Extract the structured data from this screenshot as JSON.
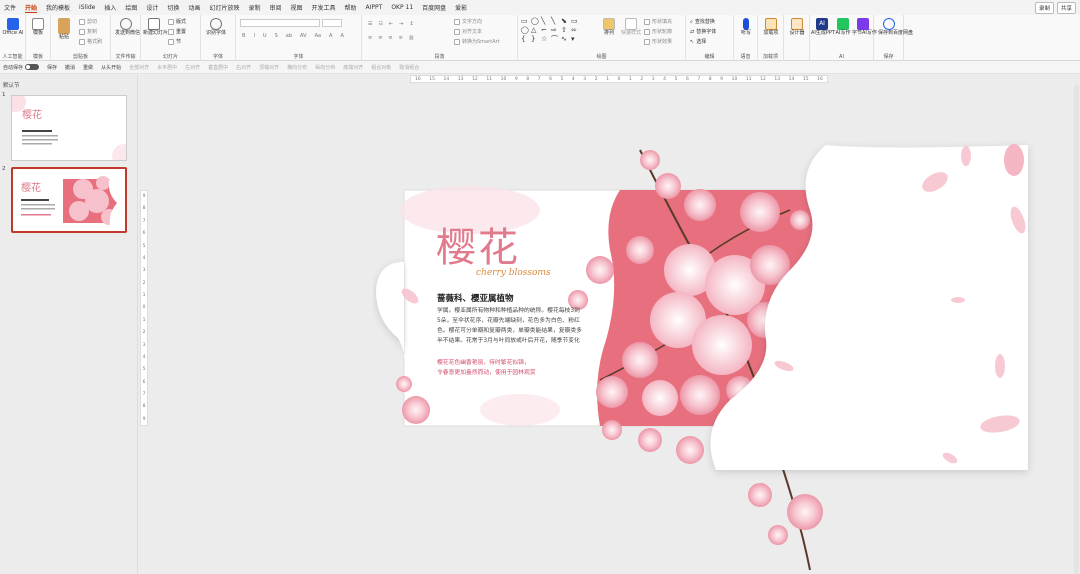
{
  "menu": {
    "tabs": [
      "文件",
      "开始",
      "我的模板",
      "iSlide",
      "插入",
      "绘图",
      "设计",
      "切换",
      "动画",
      "幻灯片放映",
      "录制",
      "审阅",
      "视图",
      "开发工具",
      "帮助",
      "AIPPT",
      "OKP 11",
      "百度网盘",
      "爱影"
    ],
    "active": "开始",
    "record_button": "录制",
    "share_button": "共享"
  },
  "ribbon": {
    "groups": [
      {
        "label": "人工智能",
        "buttons": [
          "Office AI"
        ]
      },
      {
        "label": "模板",
        "buttons": [
          "模板"
        ]
      },
      {
        "label": "剪贴板",
        "buttons": [
          "粘贴"
        ],
        "small": [
          "剪切",
          "复制",
          "格式刷"
        ]
      },
      {
        "label": "文件传输",
        "buttons": [
          "发送到微信"
        ]
      },
      {
        "label": "幻灯片",
        "buttons": [
          "新建幻灯片"
        ],
        "small": [
          "版式",
          "重置",
          "节"
        ]
      },
      {
        "label": "字体",
        "buttons": [
          "识别字体"
        ],
        "small": [
          "B",
          "I",
          "U",
          "S",
          "ab",
          "AV",
          "Aa",
          "A",
          "A"
        ]
      },
      {
        "label": "段落",
        "small": [
          "文字方向",
          "对齐文本",
          "转换为SmartArt"
        ]
      },
      {
        "label": "绘图",
        "buttons": [
          "排列",
          "快速样式"
        ],
        "small": [
          "形状填充",
          "形状轮廓",
          "形状效果"
        ]
      },
      {
        "label": "编辑",
        "small": [
          "查找替换",
          "替换字体",
          "选择"
        ]
      },
      {
        "label": "语音",
        "buttons": [
          "听写"
        ]
      },
      {
        "label": "加载项",
        "buttons": [
          "加载项"
        ]
      },
      {
        "label": "",
        "buttons": [
          "设计器"
        ]
      },
      {
        "label": "AI",
        "buttons": [
          "AI生成PPT",
          "AI写作",
          "字节AI写作"
        ]
      },
      {
        "label": "保存",
        "buttons": [
          "保存到百度网盘"
        ]
      }
    ]
  },
  "quickbar": {
    "autosave": "自动保存",
    "items": [
      "保存",
      "撤消",
      "重做",
      "从头开始",
      "全部对齐",
      "水平居中",
      "左对齐",
      "垂直居中",
      "右对齐",
      "顶端对齐",
      "横向分布",
      "纵向分布",
      "底端对齐",
      "组合对象",
      "取消组合"
    ]
  },
  "ruler": {
    "h_ticks": [
      "16",
      "15",
      "14",
      "13",
      "12",
      "11",
      "10",
      "9",
      "8",
      "7",
      "6",
      "5",
      "4",
      "3",
      "2",
      "1",
      "0",
      "1",
      "2",
      "3",
      "4",
      "5",
      "6",
      "7",
      "8",
      "9",
      "10",
      "11",
      "12",
      "13",
      "14",
      "15",
      "16"
    ],
    "v_ticks": [
      "9",
      "8",
      "7",
      "6",
      "5",
      "4",
      "3",
      "2",
      "1",
      "0",
      "1",
      "2",
      "3",
      "4",
      "5",
      "6",
      "7",
      "8",
      "9"
    ]
  },
  "panel": {
    "section": "默认节",
    "slides": [
      {
        "num": "1"
      },
      {
        "num": "2",
        "selected": true
      }
    ]
  },
  "slide": {
    "title": "樱花",
    "subtitle": "cherry blossoms",
    "heading": "蔷薇科、樱亚属植物",
    "body": "学属。樱亚属所有物种和种植品种的统称。樱花每枝3到5朵，至伞状花序，花瓣先端缺刻，花色多为白色、粉红色。樱花可分单瓣和复瓣两类，单瓣类能结果，复瓣类多半不结果。花常于3月与叶同放或叶后开花，随季节变化",
    "highlight": "樱花花色幽香艳丽，待时繁花似锦，\n令春意更加盎然而动，使用于园林观赏",
    "colors": {
      "title": "#e07a8c",
      "subtitle": "#d98a3f",
      "highlight": "#d14b6a",
      "band": "#e8707e"
    }
  },
  "colors": {
    "accent": "#c2410c",
    "selected_border": "#c0392b"
  }
}
